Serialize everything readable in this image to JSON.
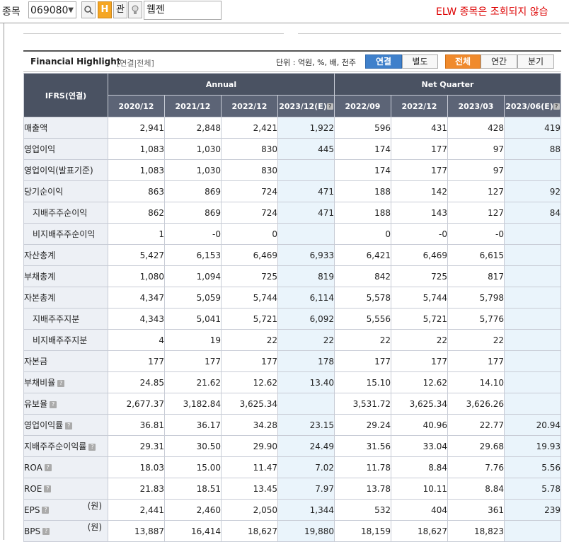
{
  "toolbar": {
    "label": "종목",
    "code": "069080",
    "dropdown": "v",
    "search_icon": "search-icon",
    "h_icon_text": "H",
    "gwan": "관",
    "bulb_icon": "bulb-icon",
    "name": "웹젠",
    "notice": "ELW 종목은 조회되지 않습"
  },
  "highlight": {
    "title": "Financial Highlight",
    "subtitle": "[연결|전체]",
    "unit": "단위 : 억원, %, 배, 천주",
    "btn_consol": "연결",
    "btn_separate": "별도",
    "btn_all": "전체",
    "btn_annual": "연간",
    "btn_quarter": "분기",
    "colors": {
      "header": "#4a5262",
      "blue": "#3f80cb",
      "orange": "#f08a2c",
      "estimate_bg": "#eaf4fb"
    }
  },
  "table": {
    "ifrs_label": "IFRS(연결)",
    "group_annual": "Annual",
    "group_quarter": "Net Quarter",
    "columns": [
      "2020/12",
      "2021/12",
      "2022/12",
      "2023/12(E)",
      "2022/09",
      "2022/12",
      "2023/03",
      "2023/06(E)"
    ],
    "estimate_badge": "?",
    "rows": [
      {
        "label": "매출액",
        "indent": false,
        "q": false,
        "unit": "",
        "values": [
          "2,941",
          "2,848",
          "2,421",
          "1,922",
          "596",
          "431",
          "428",
          "419"
        ]
      },
      {
        "label": "영업이익",
        "indent": false,
        "q": false,
        "unit": "",
        "values": [
          "1,083",
          "1,030",
          "830",
          "445",
          "174",
          "177",
          "97",
          "88"
        ]
      },
      {
        "label": "영업이익(발표기준)",
        "indent": false,
        "q": false,
        "unit": "",
        "values": [
          "1,083",
          "1,030",
          "830",
          "",
          "174",
          "177",
          "97",
          ""
        ]
      },
      {
        "label": "당기순이익",
        "indent": false,
        "q": false,
        "unit": "",
        "values": [
          "863",
          "869",
          "724",
          "471",
          "188",
          "142",
          "127",
          "92"
        ]
      },
      {
        "label": "지배주주순이익",
        "indent": true,
        "q": false,
        "unit": "",
        "values": [
          "862",
          "869",
          "724",
          "471",
          "188",
          "143",
          "127",
          "84"
        ]
      },
      {
        "label": "비지배주주순이익",
        "indent": true,
        "q": false,
        "unit": "",
        "values": [
          "1",
          "-0",
          "0",
          "",
          "0",
          "-0",
          "-0",
          ""
        ]
      },
      {
        "label": "자산총계",
        "indent": false,
        "q": false,
        "unit": "",
        "values": [
          "5,427",
          "6,153",
          "6,469",
          "6,933",
          "6,421",
          "6,469",
          "6,615",
          ""
        ]
      },
      {
        "label": "부채총계",
        "indent": false,
        "q": false,
        "unit": "",
        "values": [
          "1,080",
          "1,094",
          "725",
          "819",
          "842",
          "725",
          "817",
          ""
        ]
      },
      {
        "label": "자본총계",
        "indent": false,
        "q": false,
        "unit": "",
        "values": [
          "4,347",
          "5,059",
          "5,744",
          "6,114",
          "5,578",
          "5,744",
          "5,798",
          ""
        ]
      },
      {
        "label": "지배주주지분",
        "indent": true,
        "q": false,
        "unit": "",
        "values": [
          "4,343",
          "5,041",
          "5,721",
          "6,092",
          "5,556",
          "5,721",
          "5,776",
          ""
        ]
      },
      {
        "label": "비지배주주지분",
        "indent": true,
        "q": false,
        "unit": "",
        "values": [
          "4",
          "19",
          "22",
          "22",
          "22",
          "22",
          "22",
          ""
        ]
      },
      {
        "label": "자본금",
        "indent": false,
        "q": false,
        "unit": "",
        "values": [
          "177",
          "177",
          "177",
          "178",
          "177",
          "177",
          "177",
          ""
        ]
      },
      {
        "label": "부채비율",
        "indent": false,
        "q": true,
        "unit": "",
        "values": [
          "24.85",
          "21.62",
          "12.62",
          "13.40",
          "15.10",
          "12.62",
          "14.10",
          ""
        ]
      },
      {
        "label": "유보율",
        "indent": false,
        "q": true,
        "unit": "",
        "values": [
          "2,677.37",
          "3,182.84",
          "3,625.34",
          "",
          "3,531.72",
          "3,625.34",
          "3,626.26",
          ""
        ]
      },
      {
        "label": "영업이익률",
        "indent": false,
        "q": true,
        "unit": "",
        "values": [
          "36.81",
          "36.17",
          "34.28",
          "23.15",
          "29.24",
          "40.96",
          "22.77",
          "20.94"
        ]
      },
      {
        "label": "지배주주순이익률",
        "indent": false,
        "q": true,
        "unit": "",
        "values": [
          "29.31",
          "30.50",
          "29.90",
          "24.49",
          "31.56",
          "33.04",
          "29.68",
          "19.93"
        ]
      },
      {
        "label": "ROA",
        "indent": false,
        "q": true,
        "unit": "",
        "values": [
          "18.03",
          "15.00",
          "11.47",
          "7.02",
          "11.78",
          "8.84",
          "7.76",
          "5.56"
        ]
      },
      {
        "label": "ROE",
        "indent": false,
        "q": true,
        "unit": "",
        "values": [
          "21.83",
          "18.51",
          "13.45",
          "7.97",
          "13.78",
          "10.11",
          "8.84",
          "5.78"
        ]
      },
      {
        "label": "EPS",
        "indent": false,
        "q": true,
        "unit": "(원)",
        "values": [
          "2,441",
          "2,460",
          "2,050",
          "1,344",
          "532",
          "404",
          "361",
          "239"
        ]
      },
      {
        "label": "BPS",
        "indent": false,
        "q": true,
        "unit": "(원)",
        "values": [
          "13,887",
          "16,414",
          "18,627",
          "19,880",
          "18,159",
          "18,627",
          "18,823",
          ""
        ]
      }
    ]
  }
}
